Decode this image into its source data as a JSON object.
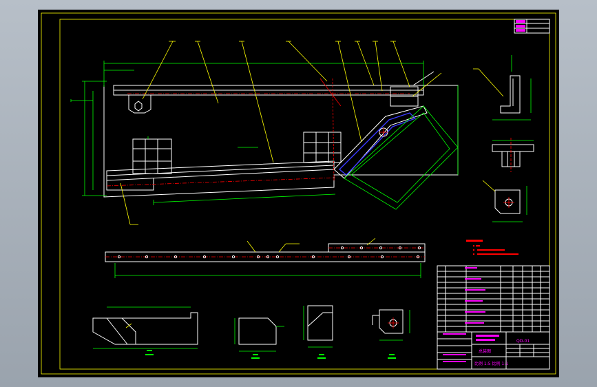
{
  "viewport": {
    "background": "#aab2bc",
    "sheet_background": "#000000"
  },
  "colors": {
    "frame": "#ffff00",
    "outline": "#ffffff",
    "dimension": "#00ff00",
    "leader": "#ffff00",
    "centerline": "#ff0000",
    "hidden": "#3a3aff",
    "titleblock": "#ff00ff"
  },
  "title_block": {
    "drawing_name": "总装图",
    "drawing_number": "QD-01",
    "scale_row": "比例 1:5  比例 1:1"
  },
  "icons": {
    "hole": "circle-icon",
    "bolt": "bolt-icon"
  }
}
